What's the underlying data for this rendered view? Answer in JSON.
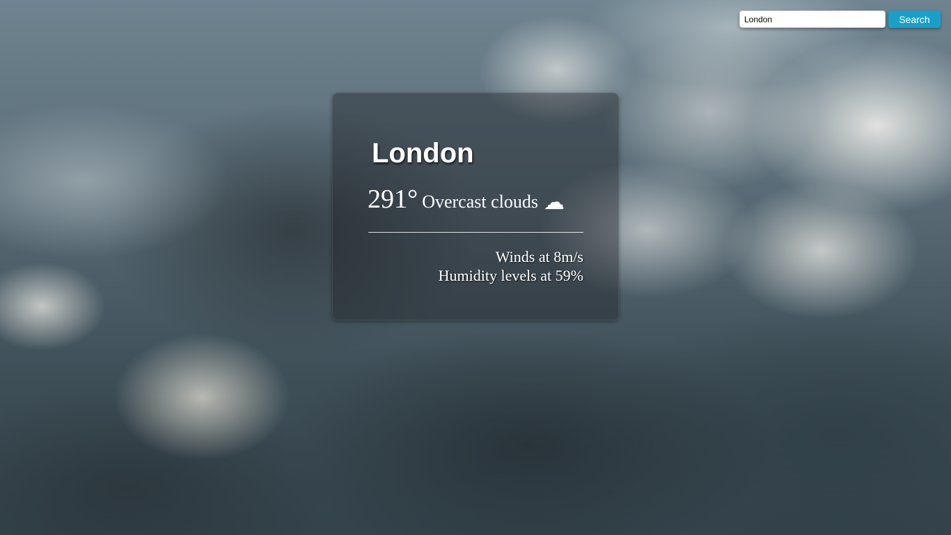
{
  "search": {
    "value": "London",
    "button_label": "Search"
  },
  "weather": {
    "city": "London",
    "temperature": "291°",
    "description": "Overcast clouds",
    "icon": "cloud-icon",
    "icon_glyph": "☁",
    "winds": "Winds at 8m/s",
    "humidity": "Humidity levels at 59%"
  }
}
